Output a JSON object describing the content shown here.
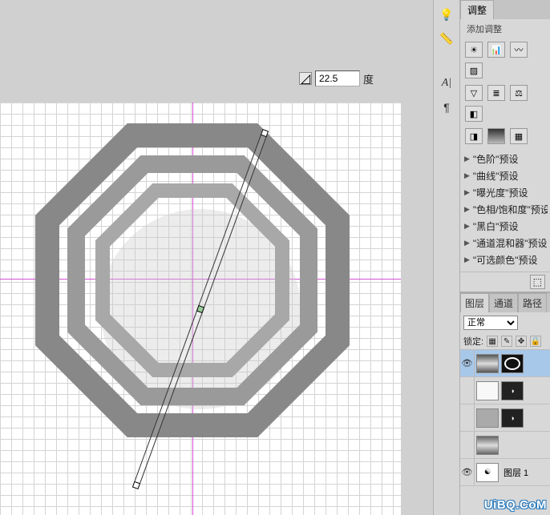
{
  "angle": {
    "value": "22.5",
    "unit": "度"
  },
  "sidebar_icons": [
    {
      "name": "bulb-icon"
    },
    {
      "name": "measuring-icon"
    },
    {
      "name": "character-icon"
    },
    {
      "name": "paragraph-icon"
    }
  ],
  "adjustments": {
    "tab": "调整",
    "subtitle": "添加调整",
    "row1": [
      "brightness",
      "levels",
      "curves",
      "exposure"
    ],
    "row2": [
      "vibrance",
      "huesat",
      "colorbalance",
      "blackwhite"
    ],
    "row3": [
      "channelmixer",
      "gradientmap",
      "selective"
    ],
    "presets": [
      "\"色阶\"预设",
      "\"曲线\"预设",
      "\"曝光度\"预设",
      "\"色相/饱和度\"预设",
      "\"黑白\"预设",
      "\"通道混和器\"预设",
      "\"可选颜色\"预设"
    ]
  },
  "layers_panel": {
    "tabs": [
      "图层",
      "通道",
      "路径"
    ],
    "blend_mode": "正常",
    "lock_label": "锁定:",
    "layers": [
      {
        "name": "",
        "selected": true,
        "has_mask": true,
        "visible": true
      },
      {
        "name": "",
        "selected": false,
        "has_mask": true,
        "visible": false
      },
      {
        "name": "",
        "selected": false,
        "has_mask": true,
        "visible": false
      },
      {
        "name": "",
        "selected": false,
        "has_mask": false,
        "visible": false
      },
      {
        "name": "图层 1",
        "selected": false,
        "has_mask": false,
        "visible": true
      }
    ]
  },
  "watermark": "UiBQ.CoM"
}
